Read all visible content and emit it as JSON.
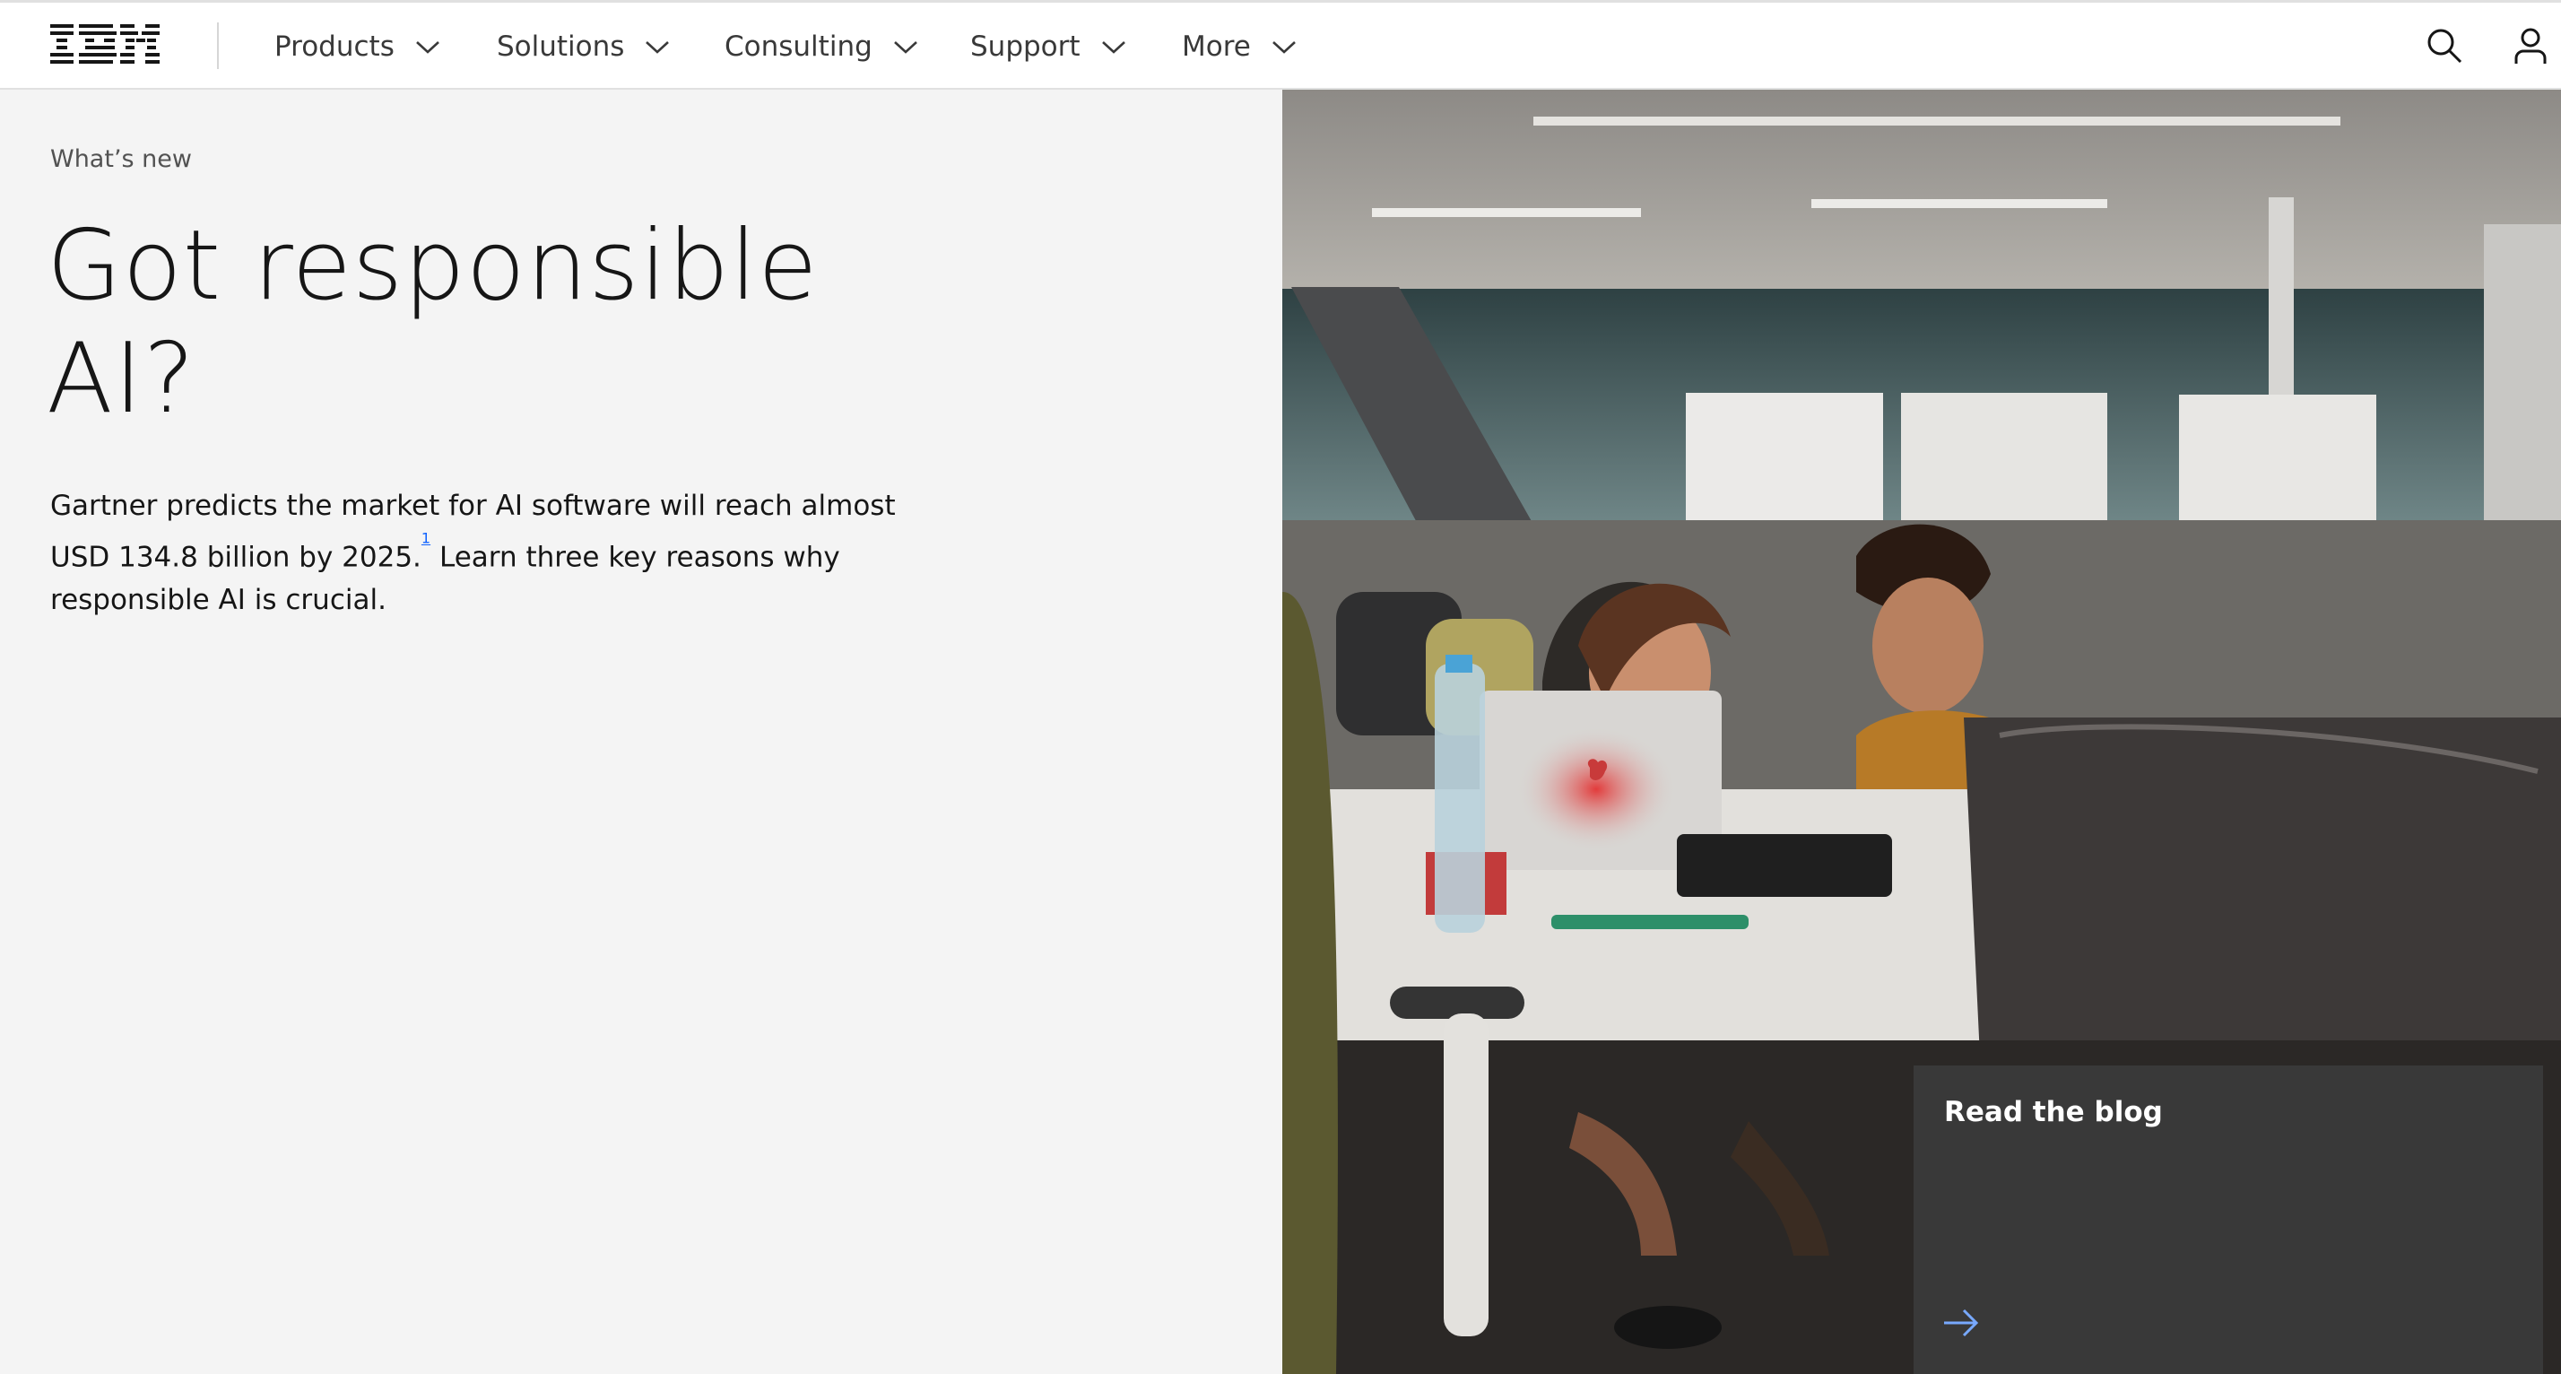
{
  "brand": {
    "logo_text": "IBM"
  },
  "nav": {
    "items": [
      {
        "label": "Products"
      },
      {
        "label": "Solutions"
      },
      {
        "label": "Consulting"
      },
      {
        "label": "Support"
      },
      {
        "label": "More"
      }
    ],
    "search_icon": "search-icon",
    "user_icon": "user-icon"
  },
  "hero": {
    "eyebrow": "What’s new",
    "title_line1": "Got responsible",
    "title_line2": "AI?",
    "body_before": "Gartner predicts the market for AI software will reach almost USD 134.8 billion by 2025.",
    "footnote": "1",
    "body_after": " Learn three key reasons why responsible AI is crucial."
  },
  "card": {
    "title": "Read the blog",
    "arrow_icon": "arrow-right-icon"
  },
  "colors": {
    "accent": "#0f62fe",
    "card_bg": "#393939",
    "page_bg": "#f4f4f4",
    "nav_bg": "#ffffff",
    "arrow": "#78a9ff"
  }
}
